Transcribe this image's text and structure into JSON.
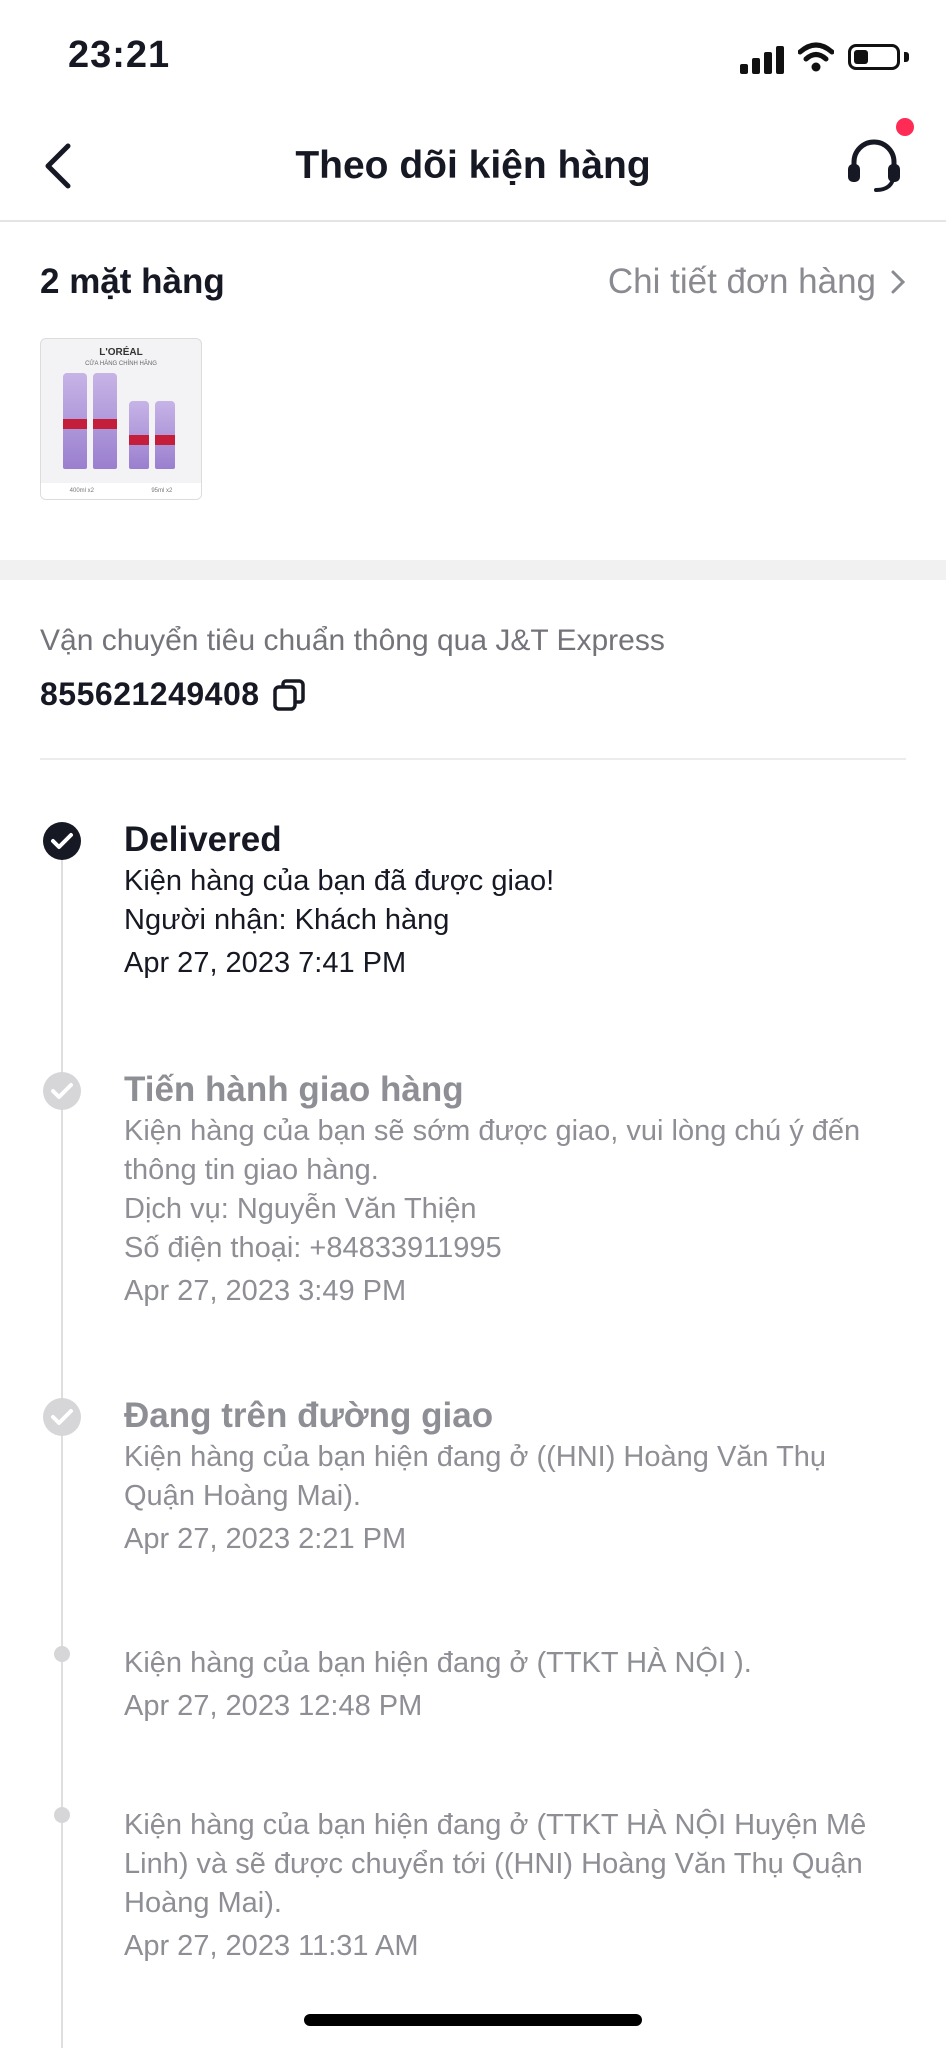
{
  "status_bar": {
    "time": "23:21"
  },
  "header": {
    "title": "Theo dõi kiện hàng"
  },
  "items": {
    "count_label": "2 mặt hàng",
    "detail_link": "Chi tiết đơn hàng",
    "thumbnail": {
      "brand": "L'ORÉAL",
      "sub": "CỬA HÀNG CHÍNH HÃNG",
      "size_a": "400ml x2",
      "size_b": "95ml x2"
    }
  },
  "shipping": {
    "method": "Vận chuyển tiêu chuẩn thông qua J&T Express",
    "tracking_number": "855621249408"
  },
  "timeline": [
    {
      "title": "Delivered",
      "lines": [
        "Kiện hàng của bạn đã được giao!",
        "Người nhận: Khách hàng"
      ],
      "date": "Apr 27, 2023 7:41 PM"
    },
    {
      "title": "Tiến hành giao hàng",
      "lines": [
        "Kiện hàng của bạn sẽ sớm được giao, vui lòng chú ý đến thông tin giao hàng.",
        "Dịch vụ: Nguyễn Văn Thiện",
        "Số điện thoại: +84833911995"
      ],
      "date": "Apr 27, 2023 3:49 PM"
    },
    {
      "title": "Đang trên đường giao",
      "lines": [
        "Kiện hàng của bạn hiện đang ở ((HNI) Hoàng Văn Thụ Quận Hoàng Mai)."
      ],
      "date": "Apr 27, 2023 2:21 PM"
    },
    {
      "lines": [
        "Kiện hàng của bạn hiện đang ở (TTKT HÀ NỘI )."
      ],
      "date": "Apr 27, 2023 12:48 PM"
    },
    {
      "lines": [
        "Kiện hàng của bạn hiện đang ở (TTKT HÀ NỘI Huyện Mê Linh) và sẽ được chuyển tới ((HNI) Hoàng Văn Thụ Quận Hoàng Mai)."
      ],
      "date": "Apr 27, 2023 11:31 AM"
    }
  ],
  "colors": {
    "accent_dot": "#fe2c55",
    "muted_text": "#8e8f95",
    "primary_text": "#161823"
  }
}
